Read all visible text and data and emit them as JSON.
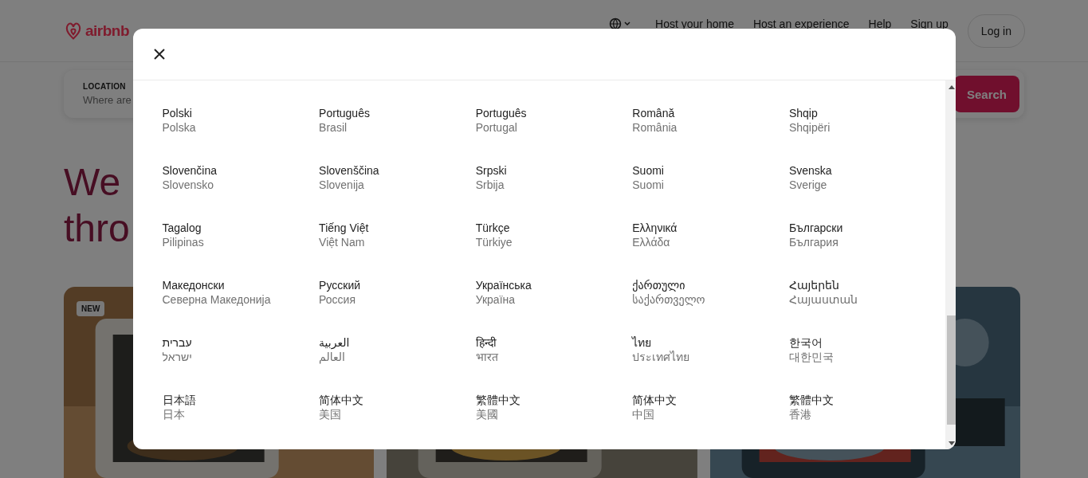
{
  "header": {
    "logo": "airbnb",
    "nav": [
      "Host your home",
      "Host an experience",
      "Help",
      "Sign up"
    ],
    "login": "Log in"
  },
  "search": {
    "label": "LOCATION",
    "placeholder": "Where are",
    "button": "Search"
  },
  "headline": [
    "We",
    "thro"
  ],
  "cards": [
    {
      "kind": "picture",
      "badge": "NEW"
    },
    {
      "kind": "picture"
    },
    {
      "kind": "picture"
    }
  ],
  "language_dialog": {
    "languages": [
      {
        "name": "Polski",
        "region": "Polska"
      },
      {
        "name": "Português",
        "region": "Brasil"
      },
      {
        "name": "Português",
        "region": "Portugal"
      },
      {
        "name": "Română",
        "region": "România"
      },
      {
        "name": "Shqip",
        "region": "Shqipëri"
      },
      {
        "name": "Slovenčina",
        "region": "Slovensko"
      },
      {
        "name": "Slovenščina",
        "region": "Slovenija"
      },
      {
        "name": "Srpski",
        "region": "Srbija"
      },
      {
        "name": "Suomi",
        "region": "Suomi"
      },
      {
        "name": "Svenska",
        "region": "Sverige"
      },
      {
        "name": "Tagalog",
        "region": "Pilipinas"
      },
      {
        "name": "Tiếng Việt",
        "region": "Việt Nam"
      },
      {
        "name": "Türkçe",
        "region": "Türkiye"
      },
      {
        "name": "Ελληνικά",
        "region": "Ελλάδα"
      },
      {
        "name": "Български",
        "region": "България"
      },
      {
        "name": "Македонски",
        "region": "Северна Македонија"
      },
      {
        "name": "Русский",
        "region": "Россия"
      },
      {
        "name": "Українська",
        "region": "Україна"
      },
      {
        "name": "ქართული",
        "region": "საქართველო"
      },
      {
        "name": "Հայերեն",
        "region": "Հայաստան"
      },
      {
        "name": "עברית",
        "region": "ישראל"
      },
      {
        "name": "العربية",
        "region": "العالم"
      },
      {
        "name": "हिन्दी",
        "region": "भारत"
      },
      {
        "name": "ไทย",
        "region": "ประเทศไทย"
      },
      {
        "name": "한국어",
        "region": "대한민국"
      },
      {
        "name": "日本語",
        "region": "日本"
      },
      {
        "name": "简体中文",
        "region": "美国"
      },
      {
        "name": "繁體中文",
        "region": "美國"
      },
      {
        "name": "简体中文",
        "region": "中国"
      },
      {
        "name": "繁體中文",
        "region": "香港"
      }
    ]
  }
}
